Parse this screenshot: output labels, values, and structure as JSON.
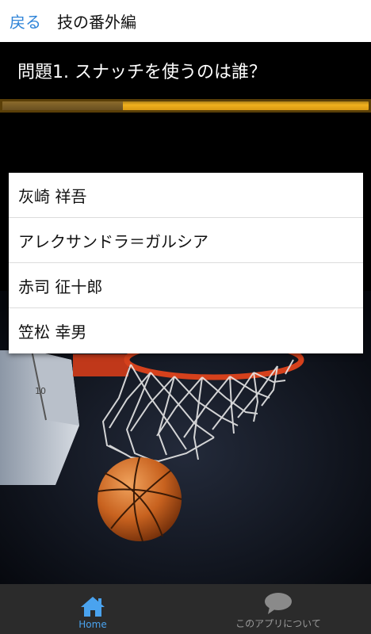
{
  "header": {
    "back_label": "戻る",
    "title": "技の番外編"
  },
  "question": {
    "text": "問題1. スナッチを使うのは誰？"
  },
  "progress": {
    "fraction": 0.33
  },
  "answers": [
    {
      "label": "灰崎 祥吾"
    },
    {
      "label": "アレクサンドラ＝ガルシア"
    },
    {
      "label": "赤司 征十郎"
    },
    {
      "label": "笠松 幸男"
    }
  ],
  "bottom_nav": {
    "home_label": "Home",
    "about_label": "このアプリについて",
    "home_icon": "home-icon",
    "about_icon": "speech-bubble-icon",
    "active_color": "#4aa3ef"
  },
  "photo": {
    "backboard_digits": "10"
  }
}
